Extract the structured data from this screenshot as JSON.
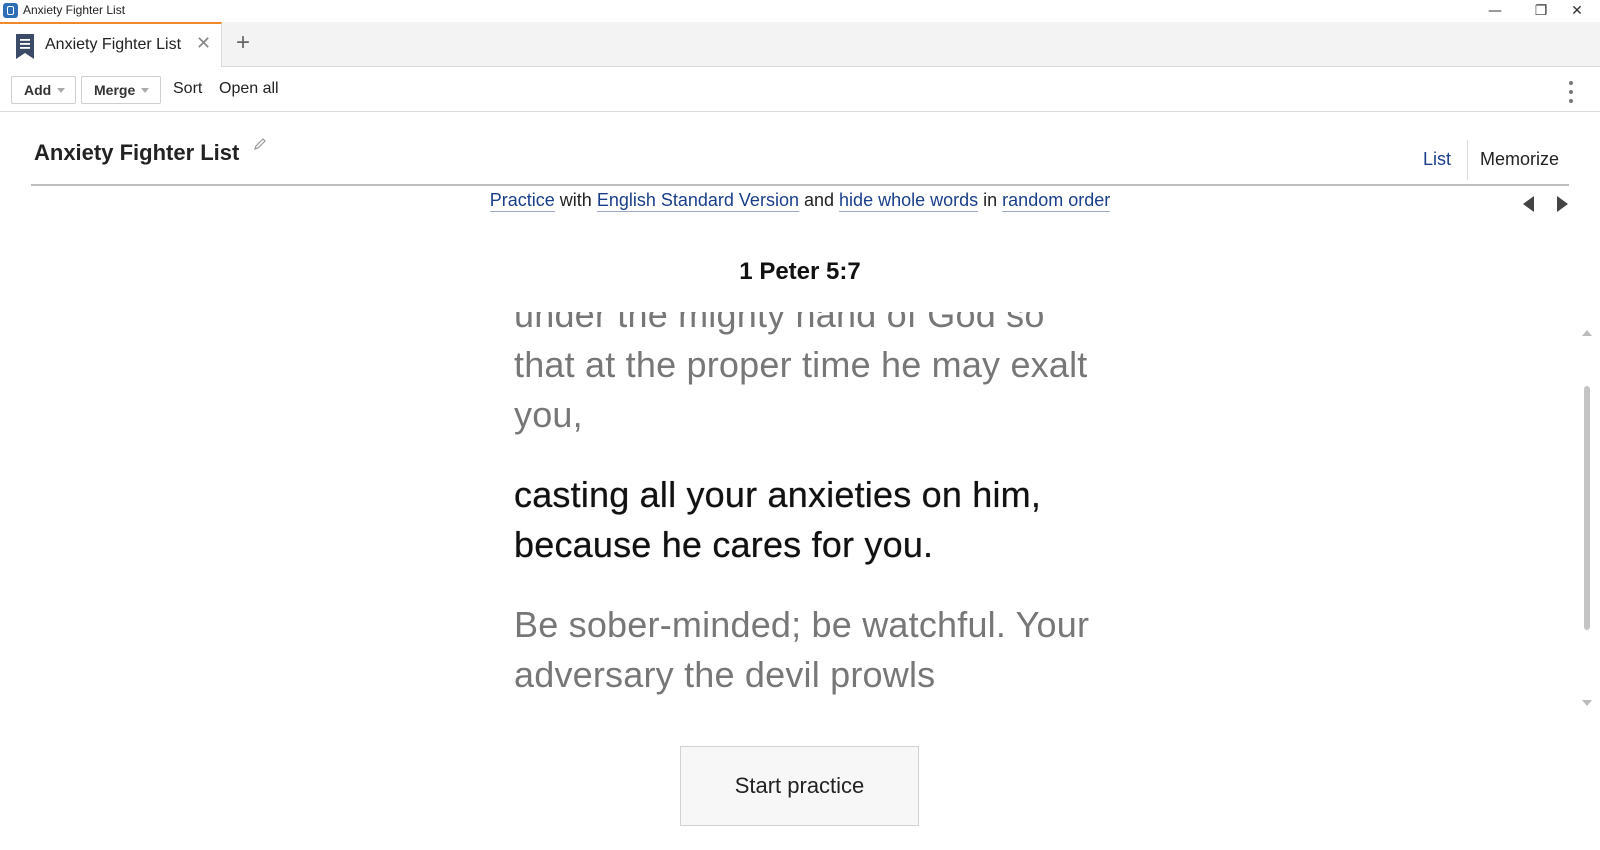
{
  "window": {
    "title": "Anxiety Fighter List",
    "controls": {
      "minimize": "—",
      "restore": "❐",
      "close": "✕"
    }
  },
  "tabs": [
    {
      "label": "Anxiety Fighter List",
      "icon": "bookmark-list-icon",
      "close": "✕"
    }
  ],
  "tab_add": "+",
  "toolbar": {
    "add_label": "Add",
    "merge_label": "Merge",
    "sort_label": "Sort",
    "open_all_label": "Open all",
    "more_icon": "kebab-menu-icon"
  },
  "header": {
    "title": "Anxiety Fighter List",
    "edit_icon": "pencil-icon",
    "view_list": "List",
    "view_memorize": "Memorize"
  },
  "practice": {
    "mode": "Practice",
    "with": "with",
    "version": "English Standard Version",
    "and": "and",
    "method": "hide whole words",
    "in": "in",
    "order": "random order"
  },
  "verse": {
    "reference": "1 Peter 5:7",
    "previous_text": "under the mighty hand of God so that at the proper time he may exalt you,",
    "text": "casting all your anxieties on him, because he cares for you.",
    "next_text": "Be sober-minded; be watchful. Your adversary the devil prowls"
  },
  "start_button": "Start practice",
  "colors": {
    "accent_tab": "#f0892c",
    "link": "#1a3f8a",
    "context_text": "#777777"
  }
}
